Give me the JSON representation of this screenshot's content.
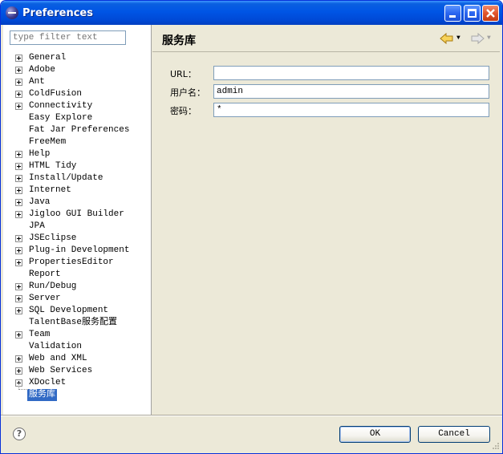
{
  "window": {
    "title": "Preferences"
  },
  "sidebar": {
    "filter_placeholder": "type filter text",
    "items": [
      {
        "label": "General",
        "expandable": true
      },
      {
        "label": "Adobe",
        "expandable": true
      },
      {
        "label": "Ant",
        "expandable": true
      },
      {
        "label": "ColdFusion",
        "expandable": true
      },
      {
        "label": "Connectivity",
        "expandable": true
      },
      {
        "label": "Easy Explore",
        "expandable": false
      },
      {
        "label": "Fat Jar Preferences",
        "expandable": false
      },
      {
        "label": "FreeMem",
        "expandable": false
      },
      {
        "label": "Help",
        "expandable": true
      },
      {
        "label": "HTML Tidy",
        "expandable": true
      },
      {
        "label": "Install/Update",
        "expandable": true
      },
      {
        "label": "Internet",
        "expandable": true
      },
      {
        "label": "Java",
        "expandable": true
      },
      {
        "label": "Jigloo GUI Builder",
        "expandable": true
      },
      {
        "label": "JPA",
        "expandable": false
      },
      {
        "label": "JSEclipse",
        "expandable": true
      },
      {
        "label": "Plug-in Development",
        "expandable": true
      },
      {
        "label": "PropertiesEditor",
        "expandable": true
      },
      {
        "label": "Report",
        "expandable": false
      },
      {
        "label": "Run/Debug",
        "expandable": true
      },
      {
        "label": "Server",
        "expandable": true
      },
      {
        "label": "SQL Development",
        "expandable": true
      },
      {
        "label": "TalentBase服务配置",
        "expandable": false
      },
      {
        "label": "Team",
        "expandable": true
      },
      {
        "label": "Validation",
        "expandable": false
      },
      {
        "label": "Web and XML",
        "expandable": true
      },
      {
        "label": "Web Services",
        "expandable": true
      },
      {
        "label": "XDoclet",
        "expandable": true
      },
      {
        "label": "服务库",
        "expandable": false,
        "selected": true
      }
    ]
  },
  "page": {
    "title": "服务库",
    "fields": [
      {
        "label": "URL：",
        "value": ""
      },
      {
        "label": "用户名：",
        "value": "admin"
      },
      {
        "label": "密码：",
        "value": "*"
      }
    ]
  },
  "footer": {
    "ok_label": "OK",
    "cancel_label": "Cancel"
  },
  "colors": {
    "titlebar": "#0055e5",
    "selection": "#316ac5",
    "dialog_bg": "#ece9d8"
  }
}
